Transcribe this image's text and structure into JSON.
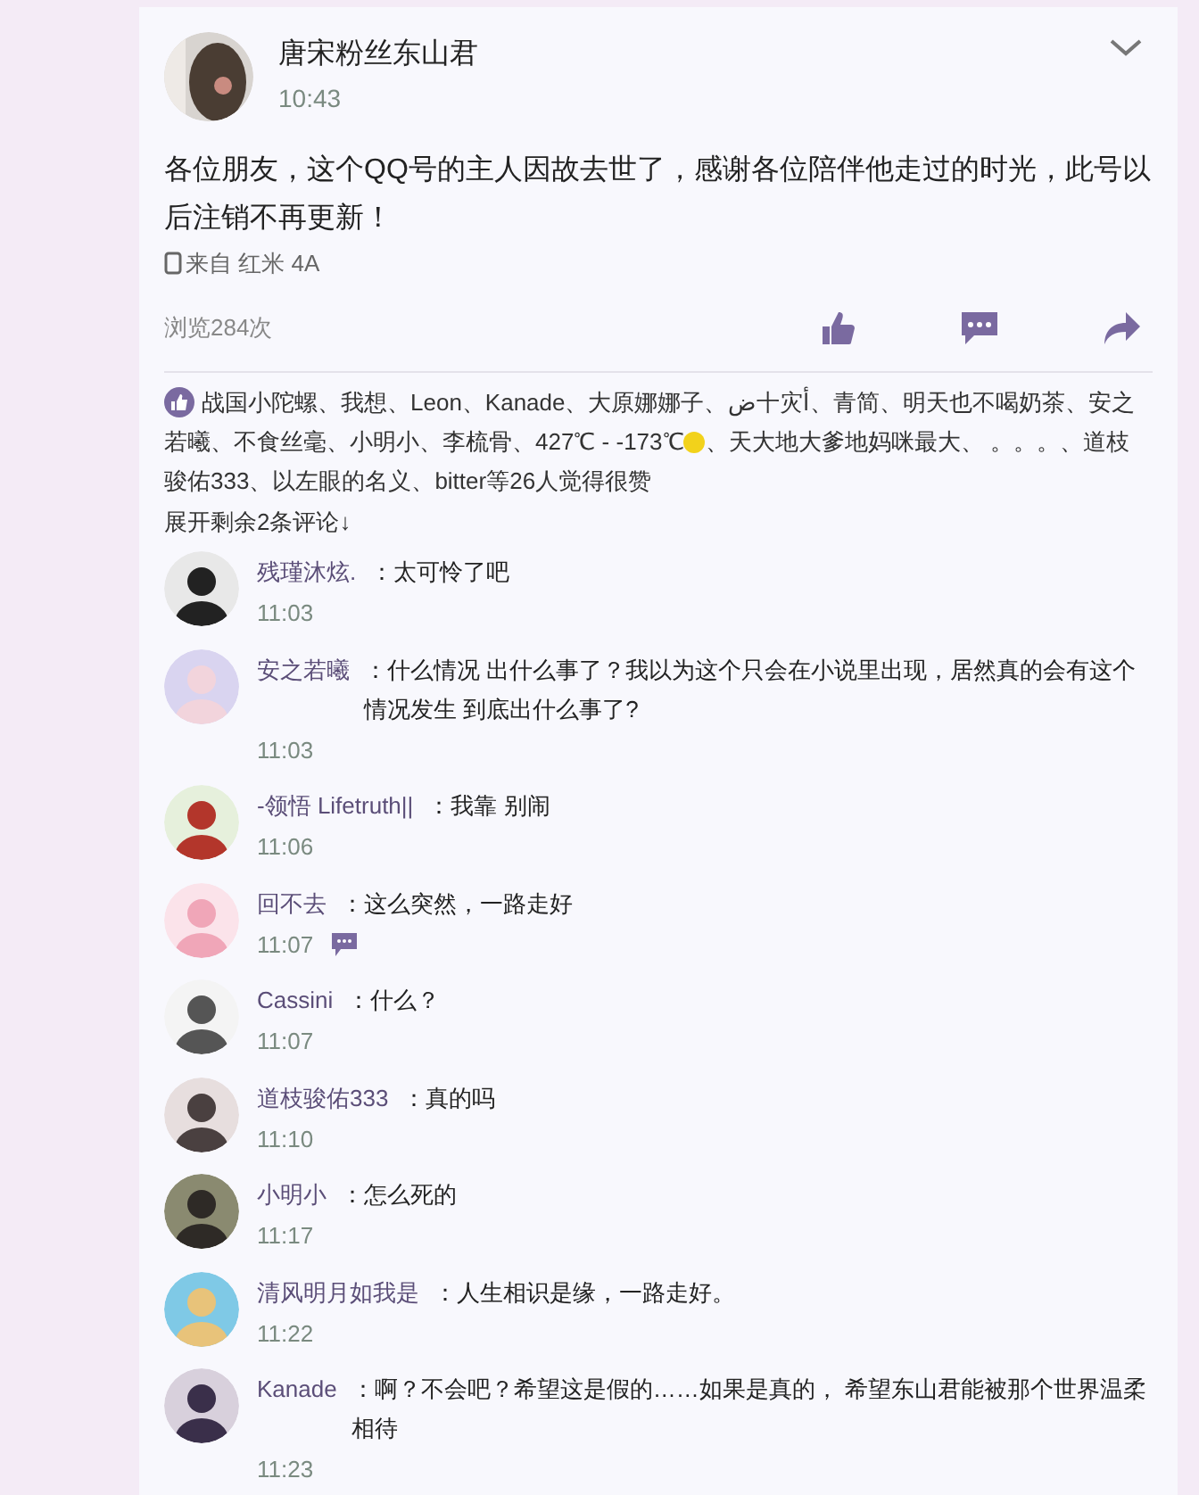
{
  "post": {
    "author": "唐宋粉丝东山君",
    "time": "10:43",
    "text": "各位朋友，这个QQ号的主人因故去世了，感谢各位陪伴他走过的时光，此号以后注销不再更新！",
    "device": "来自 红米 4A",
    "views": "浏览284次"
  },
  "likes": {
    "line_1": "战国小陀螺、我想、Leon、Kanade、大原娜娜子、ض十灾أ、青简、明天也不喝奶茶、安之",
    "line_2_before": "若曦、不食丝毫、小明小、李梳骨、427℃ - -173℃",
    "line_2_after": "、天大地大爹地妈咪最大、 。。。、道枝",
    "line_3": "骏佑333、以左眼的名义、bitter等26人觉得很赞"
  },
  "expand_link": "展开剩余2条评论↓",
  "comments": [
    {
      "name": "残瑾沐炫.",
      "text": "：太可怜了吧",
      "time": "11:03",
      "reply_icon": false
    },
    {
      "name": "安之若曦",
      "text": "：什么情况 出什么事了？我以为这个只会在小说里出现，居然真的会有这个情况发生 到底出什么事了?",
      "time": "11:03",
      "reply_icon": false
    },
    {
      "name": "-领悟 Lifetruth||",
      "text": "：我靠 别闹",
      "time": "11:06",
      "reply_icon": false
    },
    {
      "name": "回不去",
      "text": "：这么突然，一路走好",
      "time": "11:07",
      "reply_icon": true
    },
    {
      "name": "Cassini",
      "text": "：什么？",
      "time": "11:07",
      "reply_icon": false
    },
    {
      "name": "道枝骏佑333",
      "text": "：真的吗",
      "time": "11:10",
      "reply_icon": false
    },
    {
      "name": "小明小",
      "text": "：怎么死的",
      "time": "11:17",
      "reply_icon": false
    },
    {
      "name": "清风明月如我是",
      "text": "：人生相识是缘，一路走好。",
      "time": "11:22",
      "reply_icon": false
    },
    {
      "name": "Kanade",
      "text": "：啊？不会吧？希望这是假的……如果是真的， 希望东山君能被那个世界温柔相待",
      "time": "11:23",
      "reply_icon": false
    }
  ]
}
